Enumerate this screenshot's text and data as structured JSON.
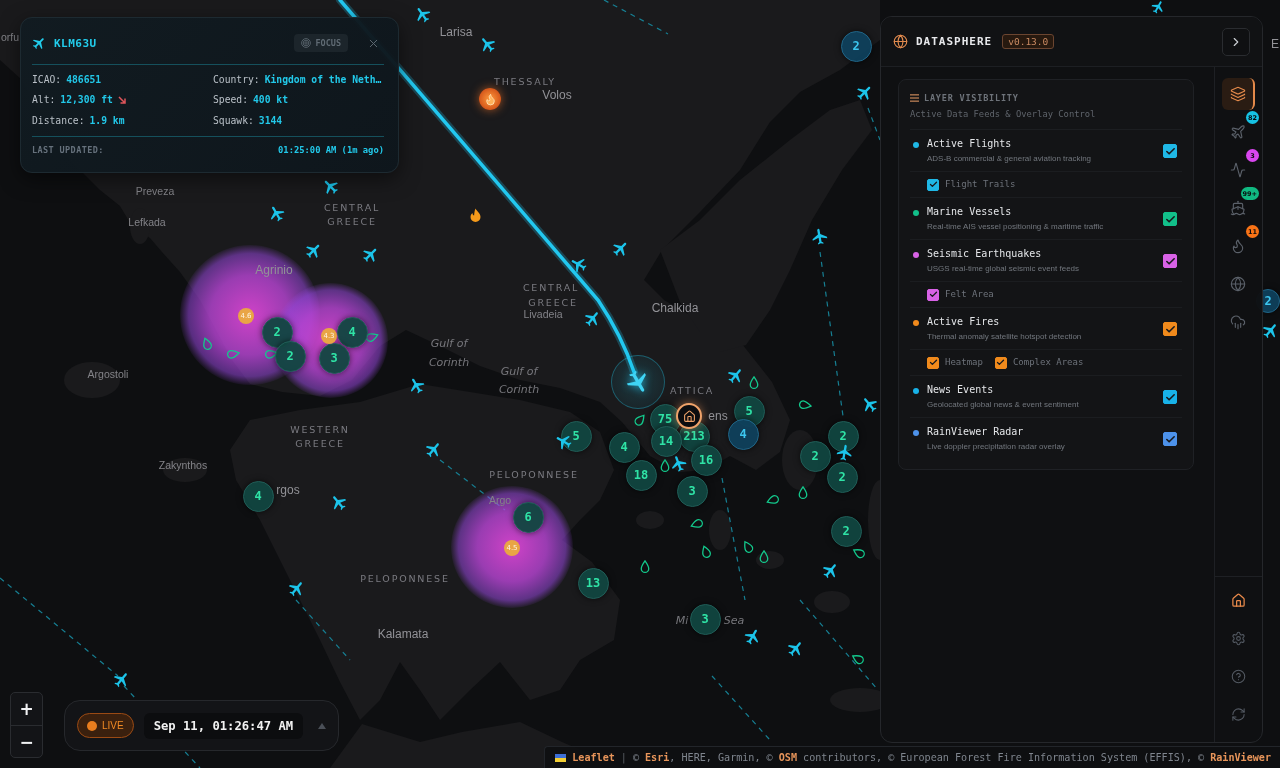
{
  "flight_card": {
    "callsign": "KLM63U",
    "focus_label": "FOCUS",
    "fields": [
      {
        "label": "ICAO:",
        "value": "486651"
      },
      {
        "label": "Country:",
        "value": "Kingdom of the Neth…"
      },
      {
        "label": "Alt:",
        "value": "12,300 ft",
        "descending": true
      },
      {
        "label": "Speed:",
        "value": "400 kt"
      },
      {
        "label": "Distance:",
        "value": "1.9 km"
      },
      {
        "label": "Squawk:",
        "value": "3144"
      }
    ],
    "updated_label": "LAST UPDATED:",
    "updated_value": "01:25:00 AM (1m ago)"
  },
  "map": {
    "labels": [
      {
        "text": "orfu",
        "kind": "town"
      },
      {
        "text": "Larisa",
        "kind": "city"
      },
      {
        "text": "THESSALY",
        "kind": "region"
      },
      {
        "text": "Volos",
        "kind": "city"
      },
      {
        "text": "Preveza",
        "kind": "town"
      },
      {
        "text": "Lefkada",
        "kind": "town"
      },
      {
        "text": "CENTRAL",
        "kind": "region"
      },
      {
        "text": "GREECE",
        "kind": "region"
      },
      {
        "text": "Agrinio",
        "kind": "city"
      },
      {
        "text": "Argostoli",
        "kind": "town"
      },
      {
        "text": "Gulf of",
        "kind": "water"
      },
      {
        "text": "Corinth",
        "kind": "water"
      },
      {
        "text": "Gulf of",
        "kind": "water"
      },
      {
        "text": "Corinth",
        "kind": "water"
      },
      {
        "text": "CENTRAL",
        "kind": "region"
      },
      {
        "text": "GREECE",
        "kind": "region"
      },
      {
        "text": "Livadeia",
        "kind": "town"
      },
      {
        "text": "Chalkida",
        "kind": "city"
      },
      {
        "text": "ATTICA",
        "kind": "region"
      },
      {
        "text": "ens",
        "kind": "city"
      },
      {
        "text": "WESTERN",
        "kind": "region"
      },
      {
        "text": "GREECE",
        "kind": "region"
      },
      {
        "text": "Zakynthos",
        "kind": "town"
      },
      {
        "text": "rgos",
        "kind": "city"
      },
      {
        "text": "PELOPONNESE",
        "kind": "region"
      },
      {
        "text": "Argo",
        "kind": "town"
      },
      {
        "text": "PELOPONNESE",
        "kind": "region"
      },
      {
        "text": "Kalamata",
        "kind": "city"
      },
      {
        "text": "Mi",
        "kind": "water"
      },
      {
        "text": "Sea",
        "kind": "water"
      },
      {
        "text": "E",
        "kind": "city"
      }
    ],
    "clusters": [
      {
        "count": "2",
        "kind": "flight"
      },
      {
        "count": "2",
        "kind": "flight"
      },
      {
        "count": "2",
        "kind": "vessel"
      },
      {
        "count": "4",
        "kind": "vessel"
      },
      {
        "count": "2",
        "kind": "vessel"
      },
      {
        "count": "3",
        "kind": "vessel"
      },
      {
        "count": "75",
        "kind": "vessel"
      },
      {
        "count": "5",
        "kind": "vessel"
      },
      {
        "count": "5",
        "kind": "vessel"
      },
      {
        "count": "4",
        "kind": "vessel"
      },
      {
        "count": "14",
        "kind": "vessel"
      },
      {
        "count": "213",
        "kind": "vessel"
      },
      {
        "count": "4",
        "kind": "flight"
      },
      {
        "count": "2",
        "kind": "vessel"
      },
      {
        "count": "16",
        "kind": "vessel"
      },
      {
        "count": "2",
        "kind": "vessel"
      },
      {
        "count": "18",
        "kind": "vessel"
      },
      {
        "count": "2",
        "kind": "vessel"
      },
      {
        "count": "4",
        "kind": "vessel"
      },
      {
        "count": "3",
        "kind": "vessel"
      },
      {
        "count": "6",
        "kind": "vessel"
      },
      {
        "count": "2",
        "kind": "vessel"
      },
      {
        "count": "13",
        "kind": "vessel"
      },
      {
        "count": "3",
        "kind": "vessel"
      }
    ],
    "earthquakes": [
      {
        "magnitude": "4.6"
      },
      {
        "magnitude": "4.3"
      },
      {
        "magnitude": "4.5"
      }
    ]
  },
  "panel": {
    "title": "DATASPHERE",
    "version": "v0.13.0",
    "section_title": "LAYER VISIBILITY",
    "section_subtitle": "Active Data Feeds & Overlay Control",
    "layers": [
      {
        "name": "Active Flights",
        "description": "ADS-B commercial & general aviation tracking",
        "color": "#1fb8e6",
        "checked": true,
        "options": [
          {
            "label": "Flight Trails",
            "checked": true
          }
        ]
      },
      {
        "name": "Marine Vessels",
        "description": "Real-time AIS vessel positioning & maritime traffic",
        "color": "#12c08a",
        "checked": true
      },
      {
        "name": "Seismic Earthquakes",
        "description": "USGS real-time global seismic event feeds",
        "color": "#d862e6",
        "checked": true,
        "options": [
          {
            "label": "Felt Area",
            "checked": true
          }
        ]
      },
      {
        "name": "Active Fires",
        "description": "Thermal anomaly satellite hotspot detection",
        "color": "#f08a1c",
        "checked": true,
        "options": [
          {
            "label": "Heatmap",
            "checked": true
          },
          {
            "label": "Complex Areas",
            "checked": true
          }
        ]
      },
      {
        "name": "News Events",
        "description": "Geolocated global news & event sentiment",
        "color": "#18b2e8",
        "checked": true
      },
      {
        "name": "RainViewer Radar",
        "description": "Live doppler precipitation radar overlay",
        "color": "#4d92ea",
        "checked": true
      }
    ],
    "rail": [
      {
        "kind": "layers",
        "selected": true
      },
      {
        "kind": "flights",
        "selected": false,
        "badge": "82",
        "color": "#16c2e4"
      },
      {
        "kind": "activity",
        "selected": false,
        "badge": "3",
        "color": "#d946ef"
      },
      {
        "kind": "vessels",
        "selected": false,
        "badge": "99+",
        "color": "#10b981"
      },
      {
        "kind": "fires",
        "selected": false,
        "badge": "11",
        "color": "#f97316"
      },
      {
        "kind": "globe",
        "selected": false
      },
      {
        "kind": "weather",
        "selected": false
      }
    ],
    "tools": [
      {
        "kind": "home",
        "selected": true
      },
      {
        "kind": "settings",
        "selected": false
      },
      {
        "kind": "help",
        "selected": false
      },
      {
        "kind": "refresh",
        "selected": false
      }
    ]
  },
  "zoom": {
    "in": "+",
    "out": "−"
  },
  "timeline": {
    "live": "LIVE",
    "time": "Sep 11, 01:26:47 AM"
  },
  "attribution": {
    "library": "Leaflet",
    "separator": "|",
    "sources": "© **Esri**, HERE, Garmin, © **OSM** contributors, © European Forest Fire Information System (EFFIS), © **RainViewer**"
  }
}
